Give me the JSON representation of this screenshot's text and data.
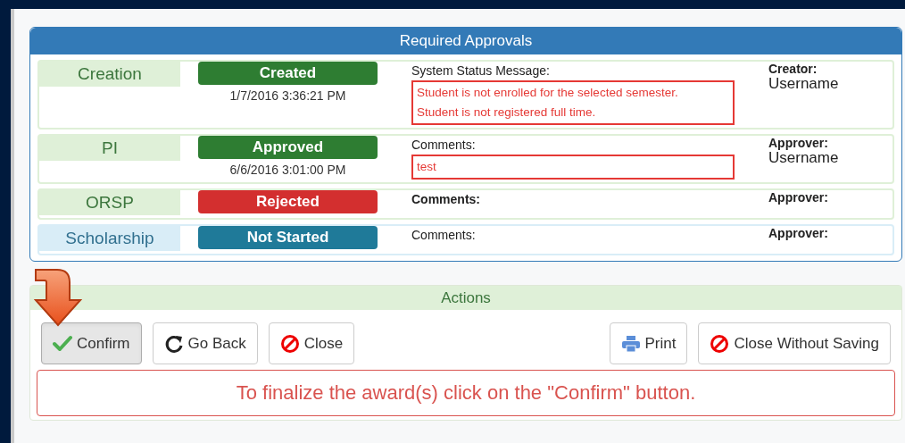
{
  "approvals": {
    "title": "Required Approvals",
    "rows": [
      {
        "stage": "Creation",
        "status": "Created",
        "kind": "success",
        "timestamp": "1/7/2016 3:36:21 PM",
        "comment_label": "System Status Message:",
        "comment_label_bold": false,
        "comment_lines": [
          "Student is not enrolled for the selected semester.",
          "Student is not registered full time."
        ],
        "person_label": "Creator:",
        "person": "Username"
      },
      {
        "stage": "PI",
        "status": "Approved",
        "kind": "success",
        "timestamp": "6/6/2016 3:01:00 PM",
        "comment_label": "Comments:",
        "comment_label_bold": false,
        "comment_lines": [
          "test"
        ],
        "person_label": "Approver:",
        "person": "Username"
      },
      {
        "stage": "ORSP",
        "status": "Rejected",
        "kind": "danger",
        "comment_label": "Comments:",
        "comment_label_bold": true,
        "person_label": "Approver:"
      },
      {
        "stage": "Scholarship",
        "status": "Not Started",
        "kind": "info",
        "comment_label": "Comments:",
        "comment_label_bold": false,
        "person_label": "Approver:"
      }
    ]
  },
  "actions": {
    "title": "Actions",
    "buttons_left": [
      {
        "label": "Confirm",
        "kind": "check",
        "active": true
      },
      {
        "label": "Go Back",
        "kind": "refresh",
        "active": false
      },
      {
        "label": "Close",
        "kind": "ban",
        "active": false
      }
    ],
    "buttons_right": [
      {
        "label": "Print",
        "kind": "print",
        "active": false
      },
      {
        "label": "Close Without Saving",
        "kind": "ban",
        "active": false
      }
    ],
    "message": "To finalize the award(s) click on the \"Confirm\" button."
  }
}
